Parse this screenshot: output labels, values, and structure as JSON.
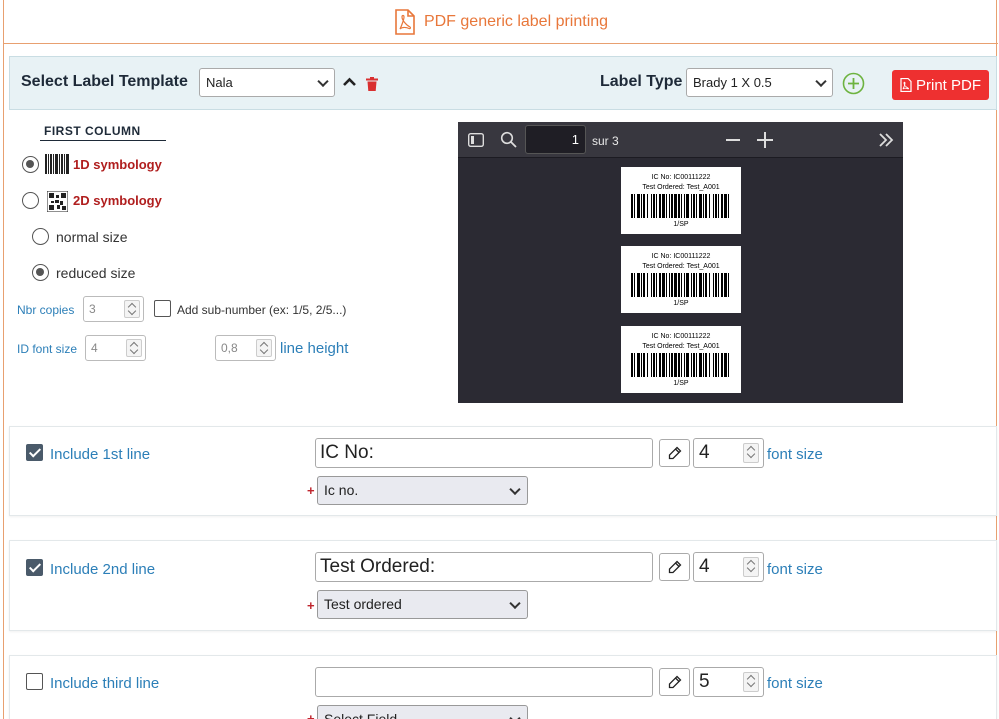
{
  "header": {
    "title": "PDF generic label printing",
    "accent_color": "#e8773a"
  },
  "template_bar": {
    "select_label": "Select Label Template",
    "template_value": "Nala",
    "label_type_label": "Label Type",
    "label_type_value": "Brady 1 X 0.5",
    "print_button": "Print PDF",
    "print_color": "#ee3030"
  },
  "column": {
    "heading": "FIRST COLUMN",
    "symbology_1d": "1D symbology",
    "symbology_2d": "2D symbology",
    "normal_size": "normal size",
    "reduced_size": "reduced size",
    "selected_symbology": "1D symbology",
    "selected_size": "reduced size",
    "nbr_copies_label": "Nbr copies",
    "nbr_copies_value": "3",
    "sub_number_label": "Add sub-number (ex: 1/5, 2/5...)",
    "id_font_size_label": "ID font size",
    "id_font_size_value": "4",
    "line_height_value": "0,8",
    "line_height_label": "line height"
  },
  "viewer": {
    "page_value": "1",
    "page_total": "sur 3",
    "labels": [
      {
        "line1": "IC No: IC00111222",
        "line2": "Test Ordered: Test_A001",
        "line3": "1/SP"
      },
      {
        "line1": "IC No: IC00111222",
        "line2": "Test Ordered: Test_A001",
        "line3": "1/SP"
      },
      {
        "line1": "IC No: IC00111222",
        "line2": "Test Ordered: Test_A001",
        "line3": "1/SP"
      }
    ]
  },
  "lines": [
    {
      "checked": true,
      "label": "Include 1st line",
      "text": "IC No:",
      "font_size": "4",
      "font_size_label": "font size",
      "field": "Ic no."
    },
    {
      "checked": true,
      "label": "Include 2nd line",
      "text": "Test Ordered:",
      "font_size": "4",
      "font_size_label": "font size",
      "field": "Test ordered"
    },
    {
      "checked": false,
      "label": "Include third line",
      "text": "",
      "font_size": "5",
      "font_size_label": "font size",
      "field": "Select Field"
    }
  ]
}
